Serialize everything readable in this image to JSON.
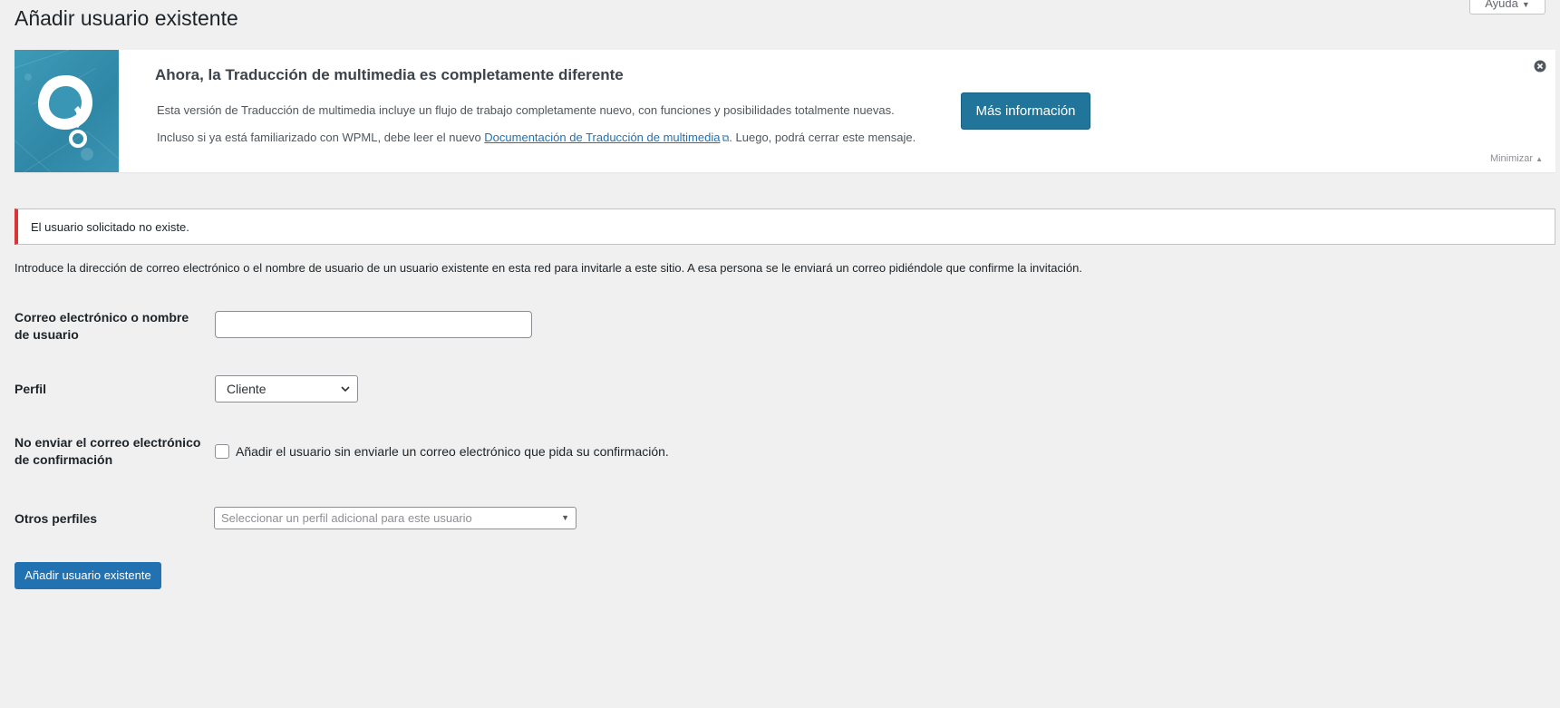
{
  "header": {
    "title": "Añadir usuario existente",
    "help_label": "Ayuda"
  },
  "wpml_notice": {
    "title": "Ahora, la Traducción de multimedia es completamente diferente",
    "line1": "Esta versión de Traducción de multimedia incluye un flujo de trabajo completamente nuevo, con funciones y posibilidades totalmente nuevas.",
    "line2_before": "Incluso si ya está familiarizado con WPML, debe leer el nuevo ",
    "line2_link": "Documentación de Traducción de multimedia",
    "line2_after": ". Luego, podrá cerrar este mensaje.",
    "button_label": "Más información",
    "minimize_label": "Minimizar",
    "logo_color": "#3d9bb8"
  },
  "error_notice": {
    "message": "El usuario solicitado no existe.",
    "accent_color": "#d63638"
  },
  "intro": "Introduce la dirección de correo electrónico o el nombre de usuario de un usuario existente en esta red para invitarle a este sitio. A esa persona se le enviará un correo pidiéndole que confirme la invitación.",
  "form": {
    "email_label": "Correo electrónico o nombre de usuario",
    "email_value": "",
    "role_label": "Perfil",
    "role_value": "Cliente",
    "noconfirm_label": "No enviar el correo electrónico de confirmación",
    "noconfirm_checkbox_label": "Añadir el usuario sin enviarle un correo electrónico que pida su confirmación.",
    "noconfirm_checked": false,
    "other_roles_label": "Otros perfiles",
    "other_roles_placeholder": "Seleccionar un perfil adicional para este usuario",
    "submit_label": "Añadir usuario existente"
  },
  "icons": [
    "caret-down-icon",
    "wpml-logo-icon",
    "external-link-icon",
    "dismiss-icon",
    "chevron-down-icon",
    "triangle-down-icon"
  ]
}
